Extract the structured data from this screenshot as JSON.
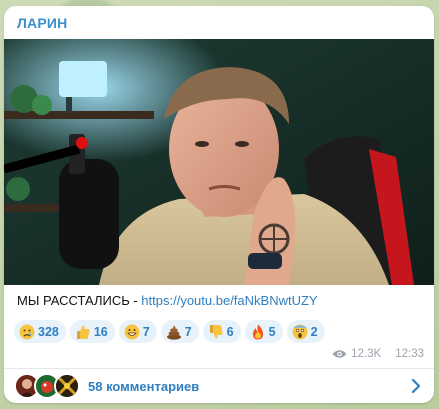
{
  "post": {
    "channel_name": "ЛАРИН",
    "text_prefix": "МЫ РАССТАЛИСЬ - ",
    "link": "https://youtu.be/faNkBNwtUZY"
  },
  "reactions": [
    {
      "icon": "crying-face-emoji",
      "count": "328"
    },
    {
      "icon": "thumbs-up-emoji",
      "count": "16"
    },
    {
      "icon": "grinning-face-emoji",
      "count": "7"
    },
    {
      "icon": "pile-of-poo-emoji",
      "count": "7"
    },
    {
      "icon": "thumbs-down-emoji",
      "count": "6"
    },
    {
      "icon": "fire-emoji",
      "count": "5"
    },
    {
      "icon": "screaming-face-emoji",
      "count": "2"
    }
  ],
  "meta": {
    "views": "12.3K",
    "time": "12:33"
  },
  "comments": {
    "label": "58 комментариев"
  },
  "colors": {
    "accent": "#2f7fc1",
    "channel": "#3a8fcc",
    "reaction_bg": "#e8f2fb",
    "meta": "#9aa3ac"
  }
}
